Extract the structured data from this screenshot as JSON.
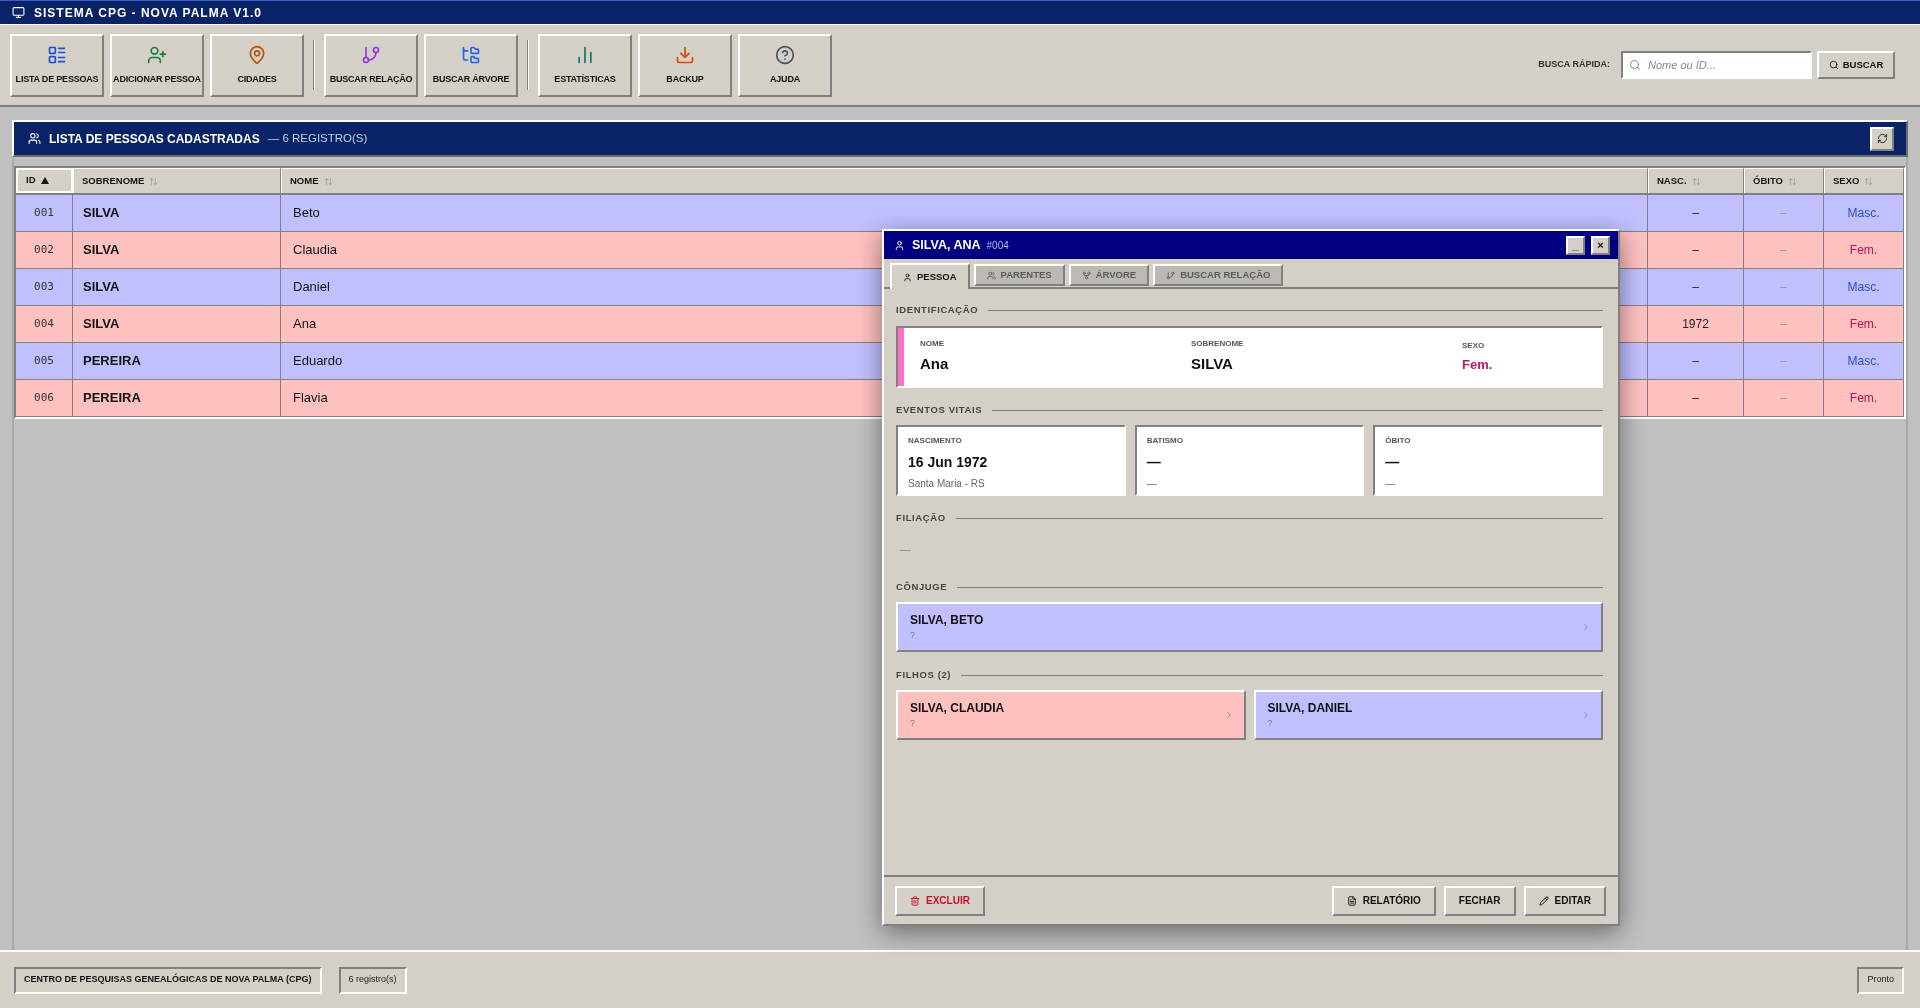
{
  "window": {
    "title": "SISTEMA CPG - NOVA PALMA V1.0"
  },
  "toolbar": {
    "groups": [
      {
        "buttons": [
          {
            "label": "LISTA DE PESSOAS"
          },
          {
            "label": "ADICIONAR PESSOA"
          },
          {
            "label": "CIDADES"
          }
        ]
      },
      {
        "buttons": [
          {
            "label": "BUSCAR RELAÇÃO"
          },
          {
            "label": "BUSCAR ÁRVORE"
          }
        ]
      },
      {
        "buttons": [
          {
            "label": "ESTATÍSTICAS"
          },
          {
            "label": "BACKUP"
          },
          {
            "label": "AJUDA"
          }
        ]
      }
    ]
  },
  "quick_search": {
    "label": "BUSCA RÁPIDA:",
    "placeholder": "Nome ou ID...",
    "button": "BUSCAR"
  },
  "list_panel": {
    "title": "LISTA DE PESSOAS CADASTRADAS",
    "count": "— 6 REGISTRO(S)"
  },
  "table": {
    "columns": [
      {
        "label": "ID",
        "sorted": true
      },
      {
        "label": "SOBRENOME",
        "sorted": false
      },
      {
        "label": "NOME",
        "sorted": false
      },
      {
        "label": "NASC.",
        "sorted": false
      },
      {
        "label": "ÓBITO",
        "sorted": false
      },
      {
        "label": "SEXO",
        "sorted": false
      }
    ],
    "rows": [
      {
        "id": "001",
        "surname": "SILVA",
        "name": "Beto",
        "birth": "–",
        "death": "–",
        "sex": {
          "label": "Masc.",
          "color": "#2f4fb8"
        },
        "color": "#c0c0ff"
      },
      {
        "id": "002",
        "surname": "SILVA",
        "name": "Claudia",
        "birth": "–",
        "death": "–",
        "sex": {
          "label": "Fem.",
          "color": "#b8105a"
        },
        "color": "#ffc0c0"
      },
      {
        "id": "003",
        "surname": "SILVA",
        "name": "Daniel",
        "birth": "–",
        "death": "–",
        "sex": {
          "label": "Masc.",
          "color": "#2f4fb8"
        },
        "color": "#c0c0ff"
      },
      {
        "id": "004",
        "surname": "SILVA",
        "name": "Ana",
        "birth": "1972",
        "death": "–",
        "sex": {
          "label": "Fem.",
          "color": "#b8105a"
        },
        "color": "#ffc0c0"
      },
      {
        "id": "005",
        "surname": "PEREIRA",
        "name": "Eduardo",
        "birth": "–",
        "death": "–",
        "sex": {
          "label": "Masc.",
          "color": "#2f4fb8"
        },
        "color": "#c0c0ff"
      },
      {
        "id": "006",
        "surname": "PEREIRA",
        "name": "Flavia",
        "birth": "–",
        "death": "–",
        "sex": {
          "label": "Fem.",
          "color": "#b8105a"
        },
        "color": "#ffc0c0"
      }
    ]
  },
  "dialog": {
    "title": "SILVA, ANA",
    "record": "#004",
    "controls": [
      "_",
      "×"
    ],
    "tabs": [
      {
        "label": "PESSOA",
        "selected": true
      },
      {
        "label": "PARENTES",
        "selected": false
      },
      {
        "label": "ÁRVORE",
        "selected": false
      },
      {
        "label": "BUSCAR RELAÇÃO",
        "selected": false
      }
    ],
    "identification": {
      "heading": "IDENTIFICAÇÃO",
      "color": "#ff6ec7",
      "fields": [
        {
          "label": "NOME",
          "value": "Ana"
        },
        {
          "label": "SOBRENOME",
          "value": "SILVA"
        },
        {
          "label": "SEXO",
          "value": "Fem.",
          "color": "#c2185b"
        }
      ]
    },
    "vital_events": {
      "heading": "EVENTOS VITAIS",
      "events": [
        {
          "label": "NASCIMENTO",
          "date": "16 Jun 1972",
          "place": "Santa Maria - RS"
        },
        {
          "label": "BATISMO",
          "date": "—",
          "place": "—"
        },
        {
          "label": "ÓBITO",
          "date": "—",
          "place": "—"
        }
      ]
    },
    "parentage": {
      "heading": "FILIAÇÃO",
      "empty_text": "—"
    },
    "spouse": {
      "heading": "CÔNJUGE",
      "people": [
        {
          "name": "SILVA, BETO",
          "detail": "?",
          "color": "#c0c0ff"
        }
      ]
    },
    "children": {
      "heading": "FILHOS (2)",
      "people": [
        {
          "name": "SILVA, CLAUDIA",
          "detail": "?",
          "color": "#ffc0c0"
        },
        {
          "name": "SILVA, DANIEL",
          "detail": "?",
          "color": "#c0c0ff"
        }
      ]
    },
    "footer": {
      "buttons": [
        {
          "label": "EXCLUIR",
          "kind": "danger"
        },
        {
          "label": "RELATÓRIO",
          "kind": "normal"
        },
        {
          "label": "FECHAR",
          "kind": "normal"
        },
        {
          "label": "EDITAR",
          "kind": "normal"
        }
      ]
    }
  },
  "status_bar": {
    "organization": "CENTRO DE PESQUISAS GENEALÓGICAS DE NOVA PALMA (CPG)",
    "count": "6 registro(s)",
    "status": "Pronto"
  }
}
